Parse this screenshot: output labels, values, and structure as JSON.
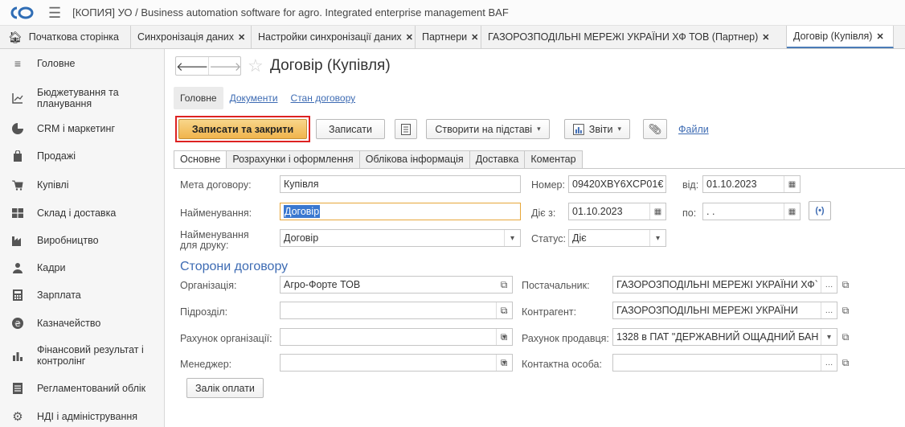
{
  "window": {
    "title": "[КОПИЯ] УО / Business automation software for agro. Integrated enterprise management BAF"
  },
  "tabs": [
    {
      "label": "Початкова сторінка"
    },
    {
      "label": "Синхронізація даних"
    },
    {
      "label": "Настройки синхронізації даних"
    },
    {
      "label": "Партнери"
    },
    {
      "label": "ГАЗОРОЗПОДІЛЬНІ МЕРЕЖІ УКРАЇНИ ХФ ТОВ (Партнер)"
    },
    {
      "label": "Договір (Купівля)"
    }
  ],
  "sidebar": {
    "items": [
      {
        "label": "Головне",
        "icon": "menu-lines-icon"
      },
      {
        "label": "Бюджетування та планування",
        "icon": "chart-axis-icon"
      },
      {
        "label": "CRM і маркетинг",
        "icon": "pie-chart-icon"
      },
      {
        "label": "Продажі",
        "icon": "shopping-bag-icon"
      },
      {
        "label": "Купівлі",
        "icon": "cart-icon"
      },
      {
        "label": "Склад і доставка",
        "icon": "warehouse-icon"
      },
      {
        "label": "Виробництво",
        "icon": "factory-icon"
      },
      {
        "label": "Кадри",
        "icon": "person-icon"
      },
      {
        "label": "Зарплата",
        "icon": "calculator-icon"
      },
      {
        "label": "Казначейство",
        "icon": "coin-icon"
      },
      {
        "label": "Фінансовий результат і контролінг",
        "icon": "bar-chart-icon"
      },
      {
        "label": "Регламентований облік",
        "icon": "ledger-icon"
      },
      {
        "label": "НДІ і адміністрування",
        "icon": "gear-icon"
      }
    ]
  },
  "doc": {
    "title": "Договір (Купівля)",
    "subtabs": [
      "Головне",
      "Документи",
      "Стан договору"
    ]
  },
  "toolbar": {
    "save_close": "Записати та закрити",
    "save": "Записати",
    "create_based": "Створити на підставі",
    "reports": "Звіти",
    "files": "Файли"
  },
  "form_tabs": [
    "Основне",
    "Розрахунки і оформлення",
    "Облікова інформація",
    "Доставка",
    "Коментар"
  ],
  "form": {
    "purpose_label": "Мета договору:",
    "purpose_value": "Купівля",
    "number_label": "Номер:",
    "number_value": "09420XBY6XCP01€",
    "from_label": "від:",
    "from_value": "01.10.2023",
    "name_label": "Найменування:",
    "name_value": "Договір",
    "valid_from_label": "Діє з:",
    "valid_from_value": "01.10.2023",
    "to_label": "по:",
    "to_value": " .  .",
    "print_name_label": "Найменування для друку:",
    "print_name_value": "Договір",
    "status_label": "Статус:",
    "status_value": "Діє"
  },
  "parties": {
    "section_title": "Сторони договору",
    "org_label": "Організація:",
    "org_value": "Агро-Форте ТОВ",
    "supplier_label": "Постачальник:",
    "supplier_value": "ГАЗОРОЗПОДІЛЬНІ МЕРЕЖІ УКРАЇНИ ХФ`",
    "division_label": "Підрозділ:",
    "division_value": "",
    "counterparty_label": "Контрагент:",
    "counterparty_value": "ГАЗОРОЗПОДІЛЬНІ МЕРЕЖІ УКРАЇНИ",
    "org_account_label": "Рахунок організації:",
    "org_account_value": "",
    "seller_account_label": "Рахунок продавця:",
    "seller_account_value": "1328 в ПАТ \"ДЕРЖАВНИЙ ОЩАДНИЙ БАН",
    "manager_label": "Менеджер:",
    "manager_value": "",
    "contact_label": "Контактна особа:",
    "contact_value": "",
    "offset_button": "Залік оплати"
  }
}
